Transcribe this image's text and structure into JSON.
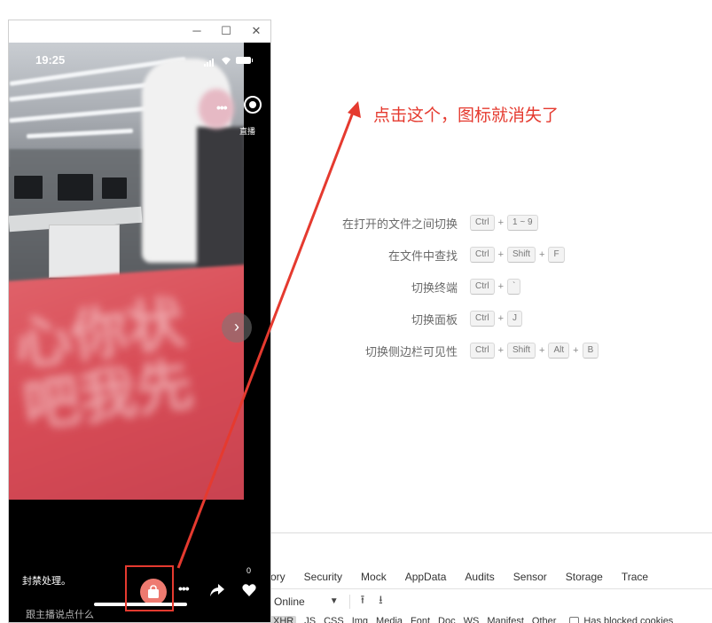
{
  "shortcuts": [
    {
      "label": "在打开的文件之间切换",
      "keys": [
        "Ctrl",
        "1 ~ 9"
      ]
    },
    {
      "label": "在文件中查找",
      "keys": [
        "Ctrl",
        "Shift",
        "F"
      ]
    },
    {
      "label": "切换终端",
      "keys": [
        "Ctrl",
        "`"
      ]
    },
    {
      "label": "切换面板",
      "keys": [
        "Ctrl",
        "J"
      ]
    },
    {
      "label": "切换侧边栏可见性",
      "keys": [
        "Ctrl",
        "Shift",
        "Alt",
        "B"
      ]
    }
  ],
  "devtools": {
    "tabs": [
      "ory",
      "Security",
      "Mock",
      "AppData",
      "Audits",
      "Sensor",
      "Storage",
      "Trace"
    ],
    "throttle": "Online",
    "filters": [
      "XHR",
      "JS",
      "CSS",
      "Img",
      "Media",
      "Font",
      "Doc",
      "WS",
      "Manifest",
      "Other"
    ],
    "active_filter": "XHR",
    "blocked_label": "Has blocked cookies"
  },
  "simulator": {
    "time": "19:25",
    "live_label": "直播",
    "notice": "封禁处理。",
    "comment_placeholder": "跟主播说点什么",
    "like_count": "0"
  },
  "annotation": {
    "text": "点击这个，图标就消失了",
    "color": "#e53a2f"
  }
}
